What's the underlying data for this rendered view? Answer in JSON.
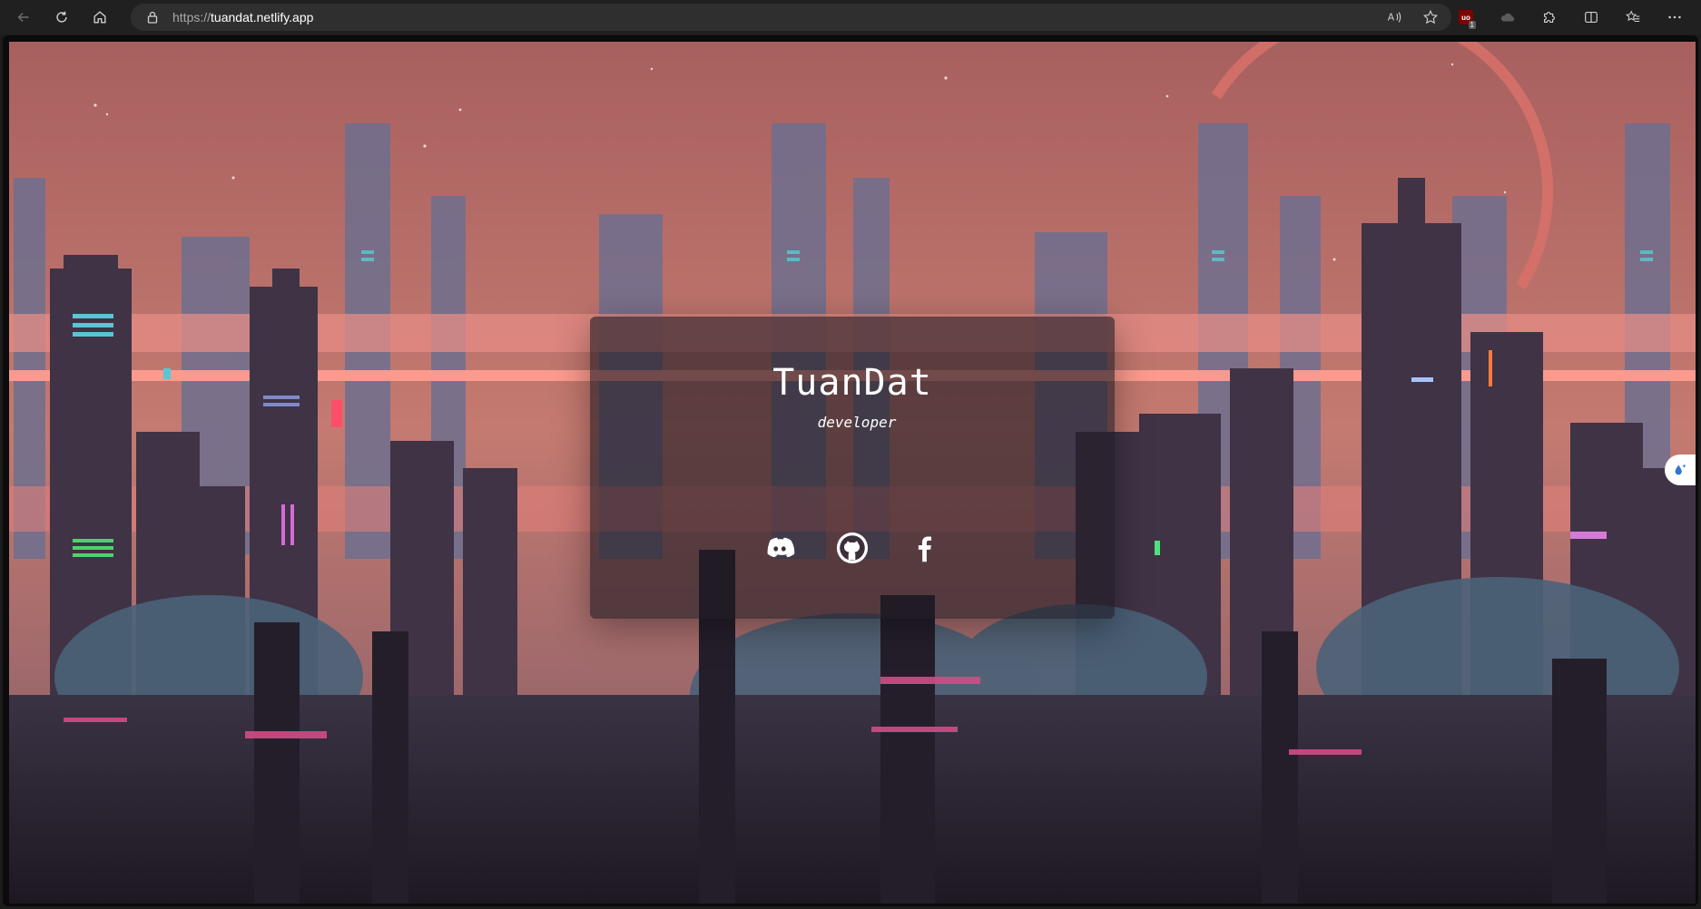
{
  "browser": {
    "url_prefix": "https://",
    "url_host": "tuandat.netlify.app",
    "extension_badge_label": "uo",
    "extension_badge_count": "1",
    "icons": {
      "back": "back-arrow-icon",
      "refresh": "refresh-icon",
      "home": "home-icon",
      "lock": "lock-icon",
      "read_aloud": "read-aloud-icon",
      "favorite": "star-icon",
      "extensions": "puzzle-icon",
      "split_screen": "split-screen-icon",
      "favorites": "favorites-list-icon",
      "more": "more-dots-icon"
    }
  },
  "card": {
    "title": "TuanDat",
    "subtitle": "developer"
  },
  "socials": [
    {
      "name": "discord",
      "icon": "discord-icon"
    },
    {
      "name": "github",
      "icon": "github-icon"
    },
    {
      "name": "facebook",
      "icon": "facebook-icon"
    }
  ],
  "colors": {
    "sky_top": "#b56a68",
    "sky_bottom": "#c97a6d",
    "band_pink": "#e88a85",
    "city_dark": "#2a2230",
    "city_blue": "#4a5877",
    "accent_teal": "#5fb8c2"
  }
}
